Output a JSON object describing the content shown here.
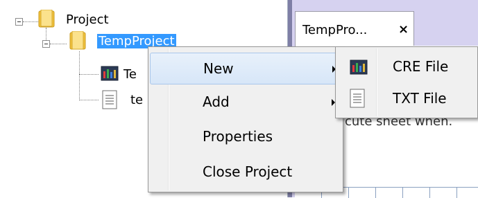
{
  "tree": {
    "root_label": "Project",
    "selected_label": "TempProject",
    "children": [
      {
        "label": "TempP",
        "visible_label": "Te",
        "icon": "cre-file-icon"
      },
      {
        "label": "temp",
        "visible_label": "te",
        "icon": "txt-file-icon"
      }
    ]
  },
  "document": {
    "tab_label": "TempPro...",
    "close_glyph": "×",
    "content_text": "cute sheet when."
  },
  "context_menu": {
    "items": [
      {
        "label": "New",
        "has_submenu": true,
        "highlighted": true
      },
      {
        "label": "Add",
        "has_submenu": true,
        "highlighted": false
      },
      {
        "label": "Properties",
        "has_submenu": false,
        "highlighted": false
      },
      {
        "label": "Close Project",
        "has_submenu": false,
        "highlighted": false
      }
    ]
  },
  "submenu": {
    "items": [
      {
        "label": "CRE File",
        "icon": "cre-file-icon"
      },
      {
        "label": "TXT File",
        "icon": "txt-file-icon"
      }
    ]
  },
  "colors": {
    "selection": "#3399ff",
    "workspace": "#d6d2f0",
    "menu_bg": "#f0f0f0"
  }
}
